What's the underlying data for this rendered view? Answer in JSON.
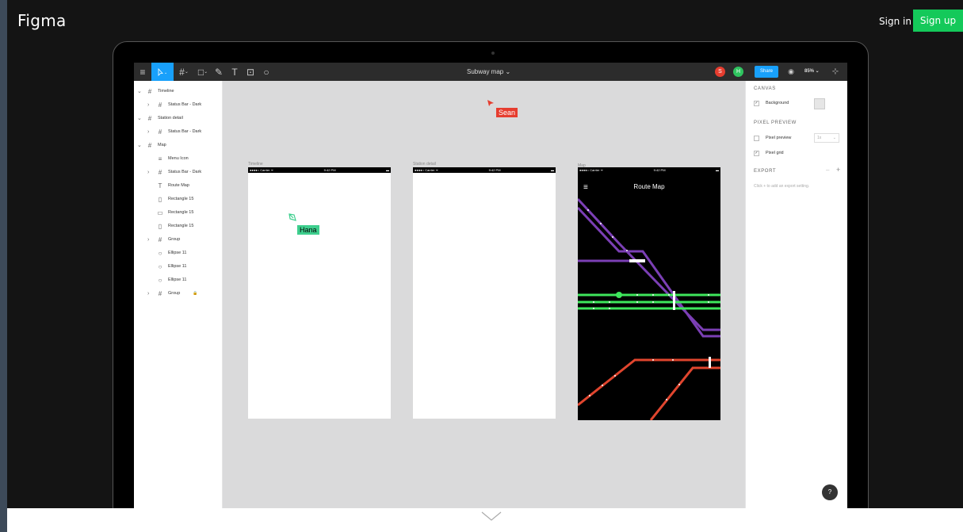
{
  "site": {
    "logo": "Figma",
    "sign_in": "Sign in",
    "sign_up": "Sign up"
  },
  "toolbar": {
    "doc_title": "Subway map ⌄",
    "share": "Share",
    "zoom": "85% ⌄",
    "avatars": [
      {
        "letter": "S",
        "color": "#e63d2f"
      },
      {
        "letter": "H",
        "color": "#2fc45f"
      }
    ]
  },
  "layers": [
    {
      "label": "Timeline",
      "arrow": "⌄",
      "icon": "#",
      "indent": 0
    },
    {
      "label": "Status Bar - Dark",
      "arrow": "›",
      "icon": "#",
      "indent": 1
    },
    {
      "label": "Station detail",
      "arrow": "⌄",
      "icon": "#",
      "indent": 0
    },
    {
      "label": "Status Bar - Dark",
      "arrow": "›",
      "icon": "#",
      "indent": 1
    },
    {
      "label": "Map",
      "arrow": "⌄",
      "icon": "#",
      "indent": 0
    },
    {
      "label": "Menu Icon",
      "arrow": "",
      "icon": "≡",
      "indent": 1
    },
    {
      "label": "Status Bar - Dark",
      "arrow": "›",
      "icon": "#",
      "indent": 1
    },
    {
      "label": "Route Map",
      "arrow": "",
      "icon": "T",
      "indent": 1
    },
    {
      "label": "Rectangle 15",
      "arrow": "",
      "icon": "▯",
      "indent": 1
    },
    {
      "label": "Rectangle 15",
      "arrow": "",
      "icon": "▭",
      "indent": 1
    },
    {
      "label": "Rectangle 15",
      "arrow": "",
      "icon": "▯",
      "indent": 1
    },
    {
      "label": "Group",
      "arrow": "›",
      "icon": "#",
      "indent": 1
    },
    {
      "label": "Ellipse 11",
      "arrow": "",
      "icon": "○",
      "indent": 1
    },
    {
      "label": "Ellipse 11",
      "arrow": "",
      "icon": "○",
      "indent": 1
    },
    {
      "label": "Ellipse 11",
      "arrow": "",
      "icon": "○",
      "indent": 1
    },
    {
      "label": "Group",
      "arrow": "›",
      "icon": "#",
      "indent": 1,
      "locked": true
    }
  ],
  "properties": {
    "canvas_title": "CANVAS",
    "background_label": "Background",
    "pixel_preview_title": "PIXEL PREVIEW",
    "pixel_preview_label": "Pixel preview",
    "pixel_preview_value": "1x",
    "pixel_grid_label": "Pixel grid",
    "export_title": "EXPORT",
    "export_hint": "Click + to add an export setting.",
    "check": "✓"
  },
  "frames": [
    {
      "label": "Timeline",
      "carrier": "●●●●○ Carrier ᯤ",
      "time": "9:42 PM"
    },
    {
      "label": "Station detail",
      "carrier": "●●●●○ Carrier ᯤ",
      "time": "9:42 PM"
    },
    {
      "label": "Map",
      "carrier": "●●●●○ Carrier ᯤ",
      "time": "9:42 PM",
      "title": "Route Map"
    }
  ],
  "cursors": [
    {
      "name": "Sean",
      "color": "#e63d2f"
    },
    {
      "name": "Hana",
      "color": "#3ecf8e"
    }
  ],
  "help": "?"
}
